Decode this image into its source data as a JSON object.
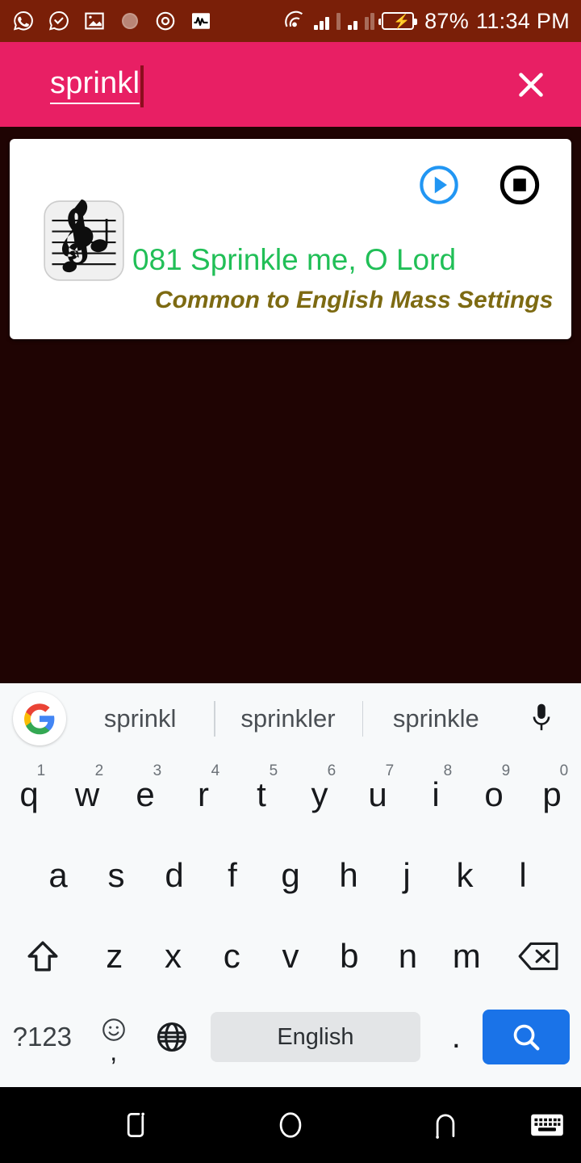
{
  "status_bar": {
    "icons": [
      "whatsapp-icon",
      "messenger-check-icon",
      "image-icon",
      "circle-dot-icon",
      "target-icon",
      "pulse-icon"
    ],
    "network_icon": "cast-signal-icon",
    "battery_percent": "87%",
    "time": "11:34 PM",
    "background_color": "#7a1f08",
    "text_color": "#ffffff"
  },
  "search_bar": {
    "query": "sprinkl",
    "close_label": "close-search",
    "background_color": "#e81f64",
    "caret_color": "#8c0e1e"
  },
  "result_card": {
    "icon": "music-score-icon",
    "title": "081 Sprinkle me, O Lord",
    "subtitle": "Common to English Mass Settings",
    "title_color": "#21bf57",
    "subtitle_color": "#7d6a12",
    "play_label": "play",
    "stop_label": "stop",
    "play_color": "#2196f3",
    "stop_color": "#000000"
  },
  "keyboard": {
    "logo": "google-g-icon",
    "suggestions": [
      "sprinkl",
      "sprinkler",
      "sprinkle"
    ],
    "mic_label": "voice-input",
    "row1": [
      {
        "key": "q",
        "hint": "1"
      },
      {
        "key": "w",
        "hint": "2"
      },
      {
        "key": "e",
        "hint": "3"
      },
      {
        "key": "r",
        "hint": "4"
      },
      {
        "key": "t",
        "hint": "5"
      },
      {
        "key": "y",
        "hint": "6"
      },
      {
        "key": "u",
        "hint": "7"
      },
      {
        "key": "i",
        "hint": "8"
      },
      {
        "key": "o",
        "hint": "9"
      },
      {
        "key": "p",
        "hint": "0"
      }
    ],
    "row2": [
      "a",
      "s",
      "d",
      "f",
      "g",
      "h",
      "j",
      "k",
      "l"
    ],
    "row3": [
      "z",
      "x",
      "c",
      "v",
      "b",
      "n",
      "m"
    ],
    "shift_label": "shift",
    "backspace_label": "backspace",
    "symbols_label": "?123",
    "emoji_label": ",",
    "language_label": "globe",
    "space_label": "English",
    "period_label": ".",
    "search_key_label": "search",
    "search_key_color": "#1a73e8",
    "background_color": "#f7f9fa",
    "space_key_color": "#e3e5e7"
  },
  "nav_bar": {
    "recents_label": "recents",
    "home_label": "home",
    "back_label": "back",
    "keyboard_label": "hide-keyboard",
    "background_color": "#000000"
  },
  "app": {
    "background_color": "#1f0403"
  }
}
